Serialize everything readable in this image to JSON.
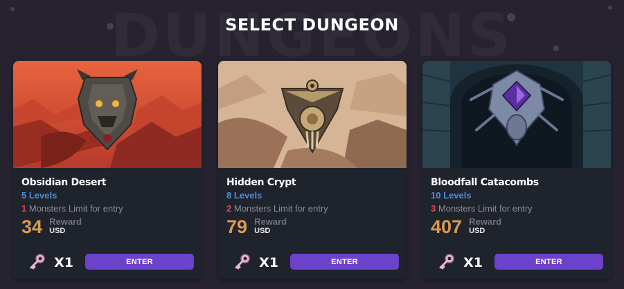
{
  "page": {
    "title": "SELECT DUNGEON",
    "watermark": "DUNGEONS"
  },
  "dungeons": [
    {
      "name": "Obsidian Desert",
      "levels": "5 Levels",
      "monster_limit": "1",
      "monster_limit_text": "Monsters Limit for entry",
      "reward_value": "34",
      "reward_label": "Reward",
      "reward_currency": "USD",
      "key_count": "X1",
      "enter_label": "ENTER",
      "art_icon": "demon-skull-emblem-icon"
    },
    {
      "name": "Hidden Crypt",
      "levels": "8 Levels",
      "monster_limit": "2",
      "monster_limit_text": "Monsters Limit for entry",
      "reward_value": "79",
      "reward_label": "Reward",
      "reward_currency": "USD",
      "key_count": "X1",
      "enter_label": "ENTER",
      "art_icon": "eye-shield-emblem-icon"
    },
    {
      "name": "Bloodfall Catacombs",
      "levels": "10 Levels",
      "monster_limit": "3",
      "monster_limit_text": "Monsters Limit for entry",
      "reward_value": "407",
      "reward_label": "Reward",
      "reward_currency": "USD",
      "key_count": "X1",
      "enter_label": "ENTER",
      "art_icon": "spider-gem-emblem-icon"
    }
  ],
  "colors": {
    "accent_button": "#6b42c9",
    "levels": "#4a8fe0",
    "limit_number": "#e0464e",
    "reward_value": "#d99a52"
  }
}
